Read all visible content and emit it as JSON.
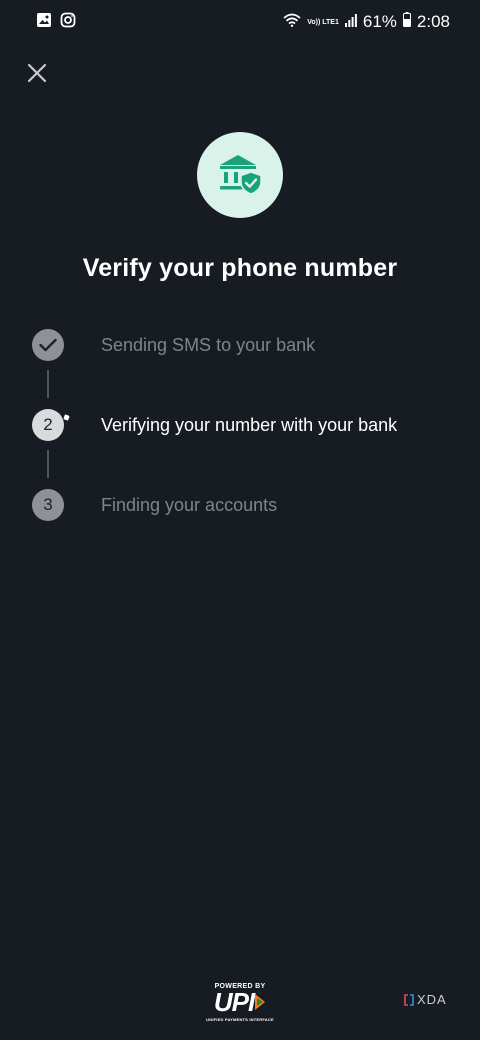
{
  "status_bar": {
    "volte_label": "Vo)) LTE1",
    "battery": "61%",
    "time": "2:08",
    "icons": [
      "gallery-icon",
      "instagram-icon",
      "wifi-icon",
      "signal-icon",
      "battery-icon"
    ]
  },
  "header": {
    "close_icon": "close-icon"
  },
  "bank_icon": {
    "name": "bank-shield-icon",
    "color": "#1aa37a",
    "background": "#d9f3ea"
  },
  "title": "Verify your phone number",
  "steps": [
    {
      "number": "",
      "label": "Sending SMS to your bank",
      "state": "done",
      "icon": "check-icon"
    },
    {
      "number": "2",
      "label": "Verifying your number with your bank",
      "state": "active"
    },
    {
      "number": "3",
      "label": "Finding your accounts",
      "state": "pending"
    }
  ],
  "footer": {
    "powered_by": "POWERED BY",
    "upi_logo": "UPI",
    "upi_subtitle": "UNIFIED PAYMENTS INTERFACE",
    "watermark": "XDA"
  },
  "colors": {
    "background": "#171c23",
    "muted_text": "#7f848a",
    "accent": "#1aa37a"
  }
}
